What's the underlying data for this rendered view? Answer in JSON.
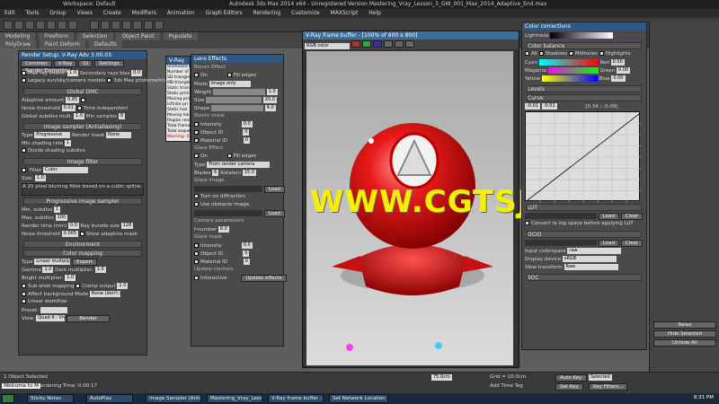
{
  "titlebar": {
    "workspace": "Workspace: Default",
    "title": "Autodesk 3ds Max 2014 x64 - Unregistered Version   Mastering_Vray_Lesson_3_GW_001_Max_2014_Adaptive_End.max"
  },
  "menu": [
    "Edit",
    "Tools",
    "Group",
    "Views",
    "Create",
    "Modifiers",
    "Animation",
    "Graph Editors",
    "Rendering",
    "Customize",
    "MAXScript",
    "Help"
  ],
  "ribbon": {
    "tabs": [
      "Modeling",
      "Freeform",
      "Selection",
      "Object Paint",
      "Populate"
    ],
    "sub": [
      "PolyDraw",
      "Paint Deform",
      "Defaults"
    ]
  },
  "render_setup": {
    "title": "Render Setup: V-Ray Adv 3.00.03",
    "tabs": [
      "Common",
      "V-Ray",
      "GI",
      "Settings",
      "Render Elements"
    ],
    "ray_max_intensity_label": "Max ray intens.",
    "ray_max_intensity": "1.0",
    "secondary_bias_label": "Secondary rays bias",
    "secondary_bias": "0.0",
    "legacy_sun": "Legacy sun/sky/camera models",
    "photometric": "3ds Max photometric scale",
    "global_dmc": "Global DMC",
    "adaptive_amount_label": "Adaptive amount",
    "adaptive_amount": "0.85",
    "min_samples_label": "Min samples",
    "min_samples": "8",
    "noise_threshold_label": "Noise threshold",
    "noise_threshold": "0.01",
    "time_independent": "Time independent",
    "global_subdivs_label": "Global subdivs mult.",
    "global_subdivs": "1.0",
    "image_sampler": "Image sampler (Antialiasing)",
    "type_label": "Type",
    "type_value": "Progressive",
    "render_mask_label": "Render mask",
    "render_mask_value": "None",
    "min_shading_label": "Min shading rate",
    "min_shading": "1",
    "divide_shading": "Divide shading subdivs",
    "image_filter": "Image filter",
    "filter_label": "Filter",
    "filter_value": "Cubic",
    "size_label": "Size:",
    "size_value": "1.0",
    "filter_desc": "A 25 pixel blurring filter based on a cubic spline.",
    "progressive": "Progressive image sampler",
    "min_subdivs_label": "Min. subdivs",
    "min_subdivs": "1",
    "max_subdivs_label": "Max. subdivs",
    "max_subdivs": "100",
    "render_time_label": "Render time (min)",
    "render_time": "0.0",
    "ray_bundle_label": "Ray bundle size",
    "ray_bundle": "128",
    "prog_noise_label": "Noise threshold",
    "prog_noise": "0.005",
    "show_adaptive": "Show adaptive mask",
    "environment": "Environment",
    "color_mapping": "Color mapping",
    "cm_type_label": "Type",
    "cm_type": "Linear multiply",
    "expert": "Expert",
    "gamma_label": "Gamma",
    "gamma": "1.0",
    "dark_mult_label": "Dark multiplier:",
    "dark_mult": "1.0",
    "bright_mult_label": "Bright multiplier:",
    "bright_mult": "1.0",
    "subpixel": "Sub-pixel mapping",
    "clamp_output": "Clamp output",
    "clamp_value": "1.0",
    "affect_bg": "Affect background",
    "mode_label": "Mode",
    "mode_value": "None (don't apply an",
    "linear_workflow": "Linear workflow",
    "preset_label": "Preset:",
    "view_label": "View:",
    "view_value": "Quad 4 - Vray_1",
    "render_btn": "Render"
  },
  "stats": {
    "title": "V-Ray",
    "lines": [
      "Unshaded b",
      "Number of e",
      "SD triangles",
      "MB triangles",
      "Static triang",
      "Static prim",
      "Moving prim",
      "Infinite pri",
      "Static hair",
      "Moving hair",
      "Region rend",
      "Total frame",
      "Total seque",
      "Warning: 0"
    ]
  },
  "lens": {
    "title": "Lens Effects",
    "bloom": "Bloom Effect",
    "on": "On",
    "fill_edges": "Fill edges",
    "mode_label": "Mode",
    "mode_value": "Image only",
    "weight_label": "Weight",
    "weight": "1.0",
    "size_label": "Size",
    "size": "20.0",
    "shape_label": "Shape",
    "shape": "4.0",
    "bloom_mask": "Bloom mask",
    "intensity": "Intensity",
    "intensity_val": "0.0",
    "object_id": "Object ID",
    "object_id_val": "0",
    "material_id": "Material ID",
    "material_id_val": "0",
    "glare": "Glare Effect",
    "glare_on": "On",
    "glare_fill": "Fill edges",
    "glare_type_label": "Type",
    "glare_type": "From render camera",
    "blades": "Blades",
    "blades_val": "6",
    "rotation": "Rotation",
    "rotation_val": "15.0",
    "glare_image": "Glare image",
    "load": "Load",
    "turn_on_diffraction": "Turn on diffraction",
    "use_obstacle": "Use obstacle image",
    "camera_params": "Camera parameters",
    "fnumber": "f-number",
    "fnumber_val": "8.0",
    "glare_mask": "Glare mask",
    "update_controls": "Update controls",
    "interactive": "Interactive",
    "update_effects": "Update effects"
  },
  "fbuffer": {
    "title": "V-Ray frame buffer - [100% of 600 x 800]",
    "channel": "RGB color"
  },
  "colorcorr": {
    "title": "Color corrections",
    "lightness_label": "Lightness",
    "color_balance": "Color balance",
    "all": "All",
    "shadows": "Shadows",
    "midtones": "Midtones",
    "highlights": "Highlights",
    "cyan": "Cyan",
    "red": "Red",
    "magenta": "Magenta",
    "green": "Green",
    "yellow": "Yellow",
    "blue": "Blue",
    "zero": "0.00",
    "levels": "Levels",
    "curve": "Curve",
    "curve_in": "-0.01",
    "curve_in2": "-0.01",
    "curve_coord": "[0.34 ; -0.09]",
    "lut": "LUT",
    "load": "Load",
    "clear": "Clear",
    "convert_lut": "Convert to log space before applying LUT",
    "ocio": "OCIO",
    "input_colorspace": "Input colorspace",
    "input_val": "raw",
    "display_device": "Display device",
    "display_val": "sRGB",
    "view_transform": "View transform",
    "view_val": "Raw",
    "soc": "SOC"
  },
  "statusbar": {
    "selected": "1 Object Selected",
    "rendering_time": "Rendering Time: 0:00:17",
    "welcome": "Welcome to M",
    "grid": "Grid = 10.0cm",
    "auto_key": "Auto Key",
    "selected_btn": "Selected",
    "set_key": "Set Key",
    "key_filters": "Key Filters...",
    "add_time_tag": "Add Time Tag",
    "coord": "75.0cm"
  },
  "cmdpanel": {
    "relax": "Relax",
    "hide_selected": "Hide Selected",
    "unhide_all": "Unhide All"
  },
  "watermark": "WWW.CGTSJ.COM",
  "taskbar": {
    "items": [
      "Sticky Notes",
      "AutoPlay",
      "Image Sampler (Anti...",
      "Mastering_Vray_Less...",
      "V-Ray frame buffer -...",
      "Set Network Location"
    ],
    "time": "8:31 PM"
  }
}
